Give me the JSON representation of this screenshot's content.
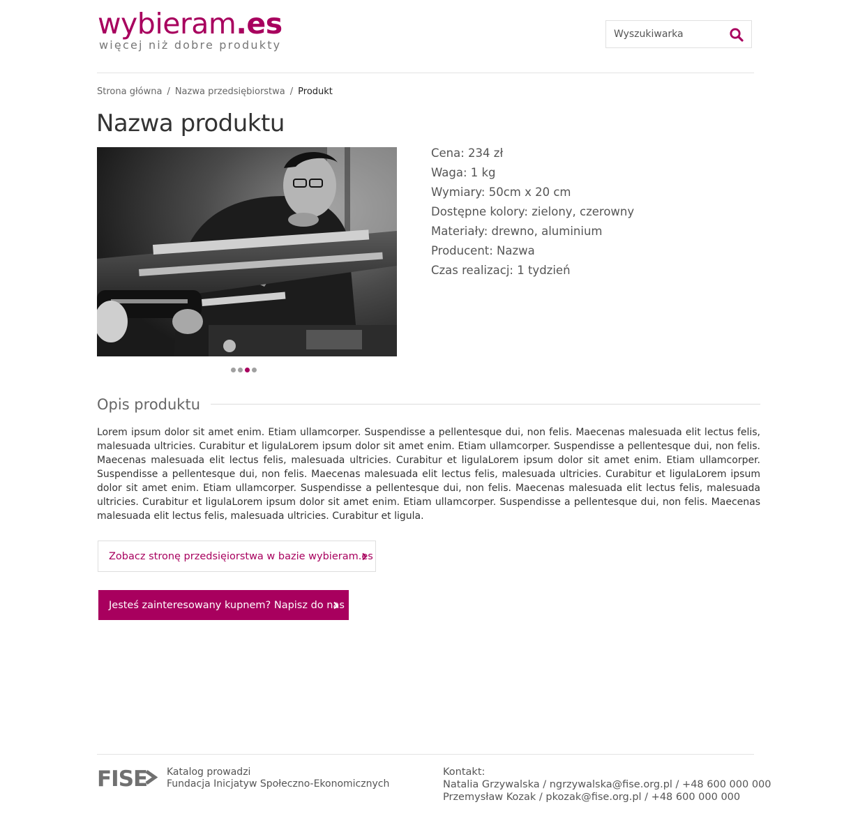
{
  "header": {
    "logo_main": "wybieram",
    "logo_tld": ".es",
    "logo_tagline": "więcej niż dobre produkty",
    "search_placeholder": "Wyszukiwarka",
    "search_icon": "search-icon",
    "accent_color": "#a8005e"
  },
  "breadcrumb": {
    "items": [
      "Strona główna",
      "Nazwa przedsiębiorstwa"
    ],
    "current": "Produkt",
    "separator": "/"
  },
  "product": {
    "title": "Nazwa produktu",
    "specs": [
      "Cena: 234 zł",
      "Waga: 1 kg",
      "Wymiary: 50cm x 20 cm",
      "Dostępne kolory: zielony, czerowny",
      "Materiały: drewno, aluminium",
      "Producent: Nazwa",
      "Czas realizacj: 1 tydzień"
    ],
    "gallery": {
      "slides": 4,
      "active_slide": 3
    }
  },
  "description": {
    "heading": "Opis produktu",
    "text": "Lorem ipsum dolor sit amet enim. Etiam ullamcorper. Suspendisse a pellentesque dui, non felis. Maecenas malesuada elit lectus felis, malesuada ultricies. Curabitur et ligulaLorem ipsum dolor sit amet enim. Etiam ullamcorper. Suspendisse a pellentesque dui, non felis. Maecenas malesuada elit lectus felis, malesuada ultricies. Curabitur et ligulaLorem ipsum dolor sit amet enim. Etiam ullamcorper. Suspendisse a pellentesque dui, non felis. Maecenas malesuada elit lectus felis, malesuada ultricies. Curabitur et ligulaLorem ipsum dolor sit amet enim. Etiam ullamcorper. Suspendisse a pellentesque dui, non felis. Maecenas malesuada elit lectus felis, malesuada ultricies. Curabitur et ligulaLorem ipsum dolor sit amet enim. Etiam ullamcorper. Suspendisse a pellentesque dui, non felis. Maecenas malesuada elit lectus felis, malesuada ultricies. Curabitur et ligula."
  },
  "actions": {
    "company_page_label": "Zobacz stronę przedsięiorstwa w bazie wybieram.es",
    "contact_label": "Jesteś zainteresowany kupnem? Napisz do nas"
  },
  "footer": {
    "org_logo_text": "FISE",
    "catalog_line1": "Katalog prowadzi",
    "catalog_line2": "Fundacja Inicjatyw Społeczno-Ekonomicznych",
    "contact_heading": "Kontakt:",
    "contacts": [
      "Natalia Grzywalska / ngrzywalska@fise.org.pl / +48 600 000 000",
      "Przemysław Kozak / pkozak@fise.org.pl / +48 600 000 000"
    ]
  }
}
